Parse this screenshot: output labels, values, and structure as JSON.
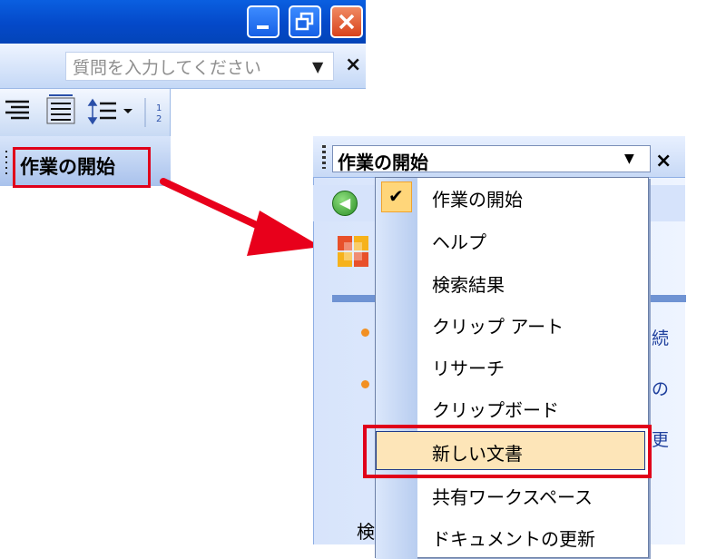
{
  "window": {
    "minimize_icon": "minimize-icon",
    "restore_icon": "restore-icon",
    "close_icon": "close-icon"
  },
  "menubar": {
    "ask_placeholder": "質問を入力してください",
    "ask_close": "×"
  },
  "task_pane_left": {
    "title": "作業の開始"
  },
  "task_pane": {
    "title": "作業の開始",
    "close": "×",
    "side_texts": [
      "続",
      "の",
      "更"
    ],
    "search_label": "検"
  },
  "dropdown": {
    "items": [
      {
        "label": "作業の開始",
        "checked": true
      },
      {
        "label": "ヘルプ"
      },
      {
        "label": "検索結果"
      },
      {
        "label": "クリップ アート"
      },
      {
        "label": "リサーチ"
      },
      {
        "label": "クリップボード"
      },
      {
        "label": "新しい文書",
        "highlighted": true
      },
      {
        "label": "共有ワークスペース"
      },
      {
        "label": "ドキュメントの更新"
      }
    ]
  },
  "colors": {
    "title_bar": "#0449c9",
    "highlight_box": "#e0001a",
    "arrow": "#e8001b",
    "selected_item_bg": "#fde5b8",
    "check_bg": "#ffd67a"
  }
}
